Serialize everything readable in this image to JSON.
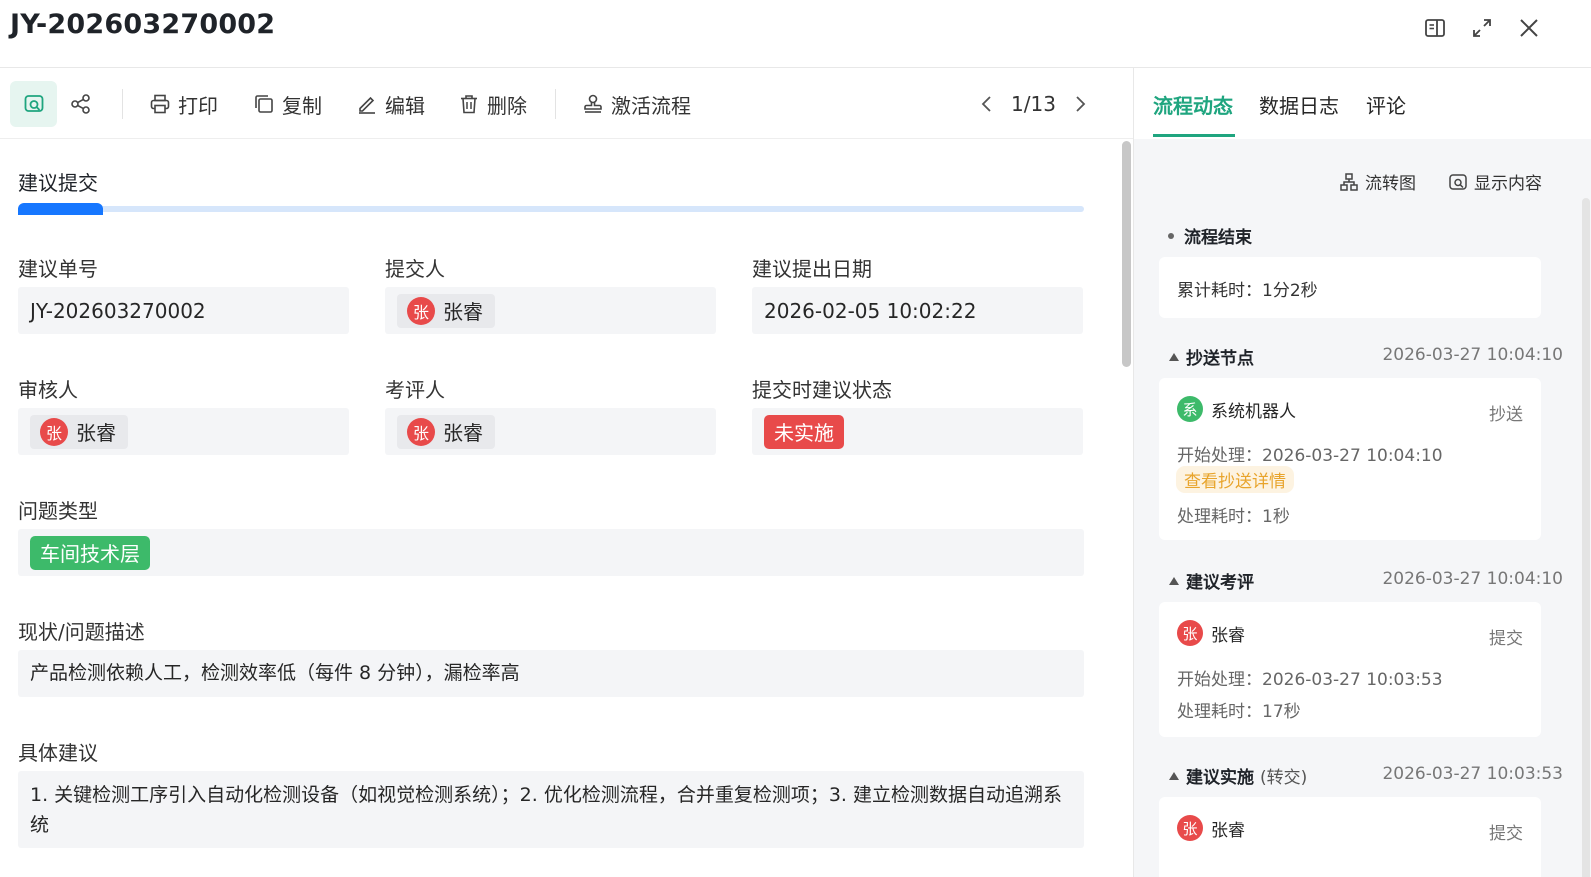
{
  "header": {
    "title": "JY-202603270002"
  },
  "toolbar": {
    "print": "打印",
    "copy": "复制",
    "edit": "编辑",
    "delete": "删除",
    "activate": "激活流程",
    "pager": "1/13"
  },
  "form": {
    "section_title": "建议提交",
    "progress_fraction": 0.08,
    "suggestion_no": {
      "label": "建议单号",
      "value": "JY-202603270002"
    },
    "submitter": {
      "label": "提交人",
      "avatar": "张",
      "name": "张睿"
    },
    "date": {
      "label": "建议提出日期",
      "value": "2026-02-05 10:02:22"
    },
    "reviewer": {
      "label": "审核人",
      "avatar": "张",
      "name": "张睿"
    },
    "evaluator": {
      "label": "考评人",
      "avatar": "张",
      "name": "张睿"
    },
    "status": {
      "label": "提交时建议状态",
      "value": "未实施",
      "color": "#e84a4a"
    },
    "problem_type": {
      "label": "问题类型",
      "value": "车间技术层",
      "color": "#3dba6a"
    },
    "description": {
      "label": "现状/问题描述",
      "value": "产品检测依赖人工，检测效率低（每件 8 分钟），漏检率高"
    },
    "suggestion": {
      "label": "具体建议",
      "value": "1. 关键检测工序引入自动化检测设备（如视觉检测系统）；2. 优化检测流程，合并重复检测项；3. 建立检测数据自动追溯系统"
    }
  },
  "side": {
    "tabs": [
      "流程动态",
      "数据日志",
      "评论"
    ],
    "flowchart": "流转图",
    "show_content": "显示内容",
    "end_node": {
      "title": "流程结束",
      "total": "累计耗时：1分2秒"
    },
    "nodes": [
      {
        "title": "抄送节点",
        "time": "2026-03-27 10:04:10",
        "avatar": "系",
        "avatar_color": "#3dba6a",
        "user": "系统机器人",
        "action": "抄送",
        "start": "开始处理：2026-03-27 10:04:10",
        "link": "查看抄送详情",
        "duration": "处理耗时：1秒"
      },
      {
        "title": "建议考评",
        "time": "2026-03-27 10:04:10",
        "avatar": "张",
        "avatar_color": "#e84a4a",
        "user": "张睿",
        "action": "提交",
        "start": "开始处理：2026-03-27 10:03:53",
        "duration": "处理耗时：17秒"
      },
      {
        "title": "建议实施",
        "subtitle": "(转交)",
        "time": "2026-03-27 10:03:53",
        "avatar": "张",
        "avatar_color": "#e84a4a",
        "user": "张睿",
        "action": "提交"
      }
    ]
  }
}
